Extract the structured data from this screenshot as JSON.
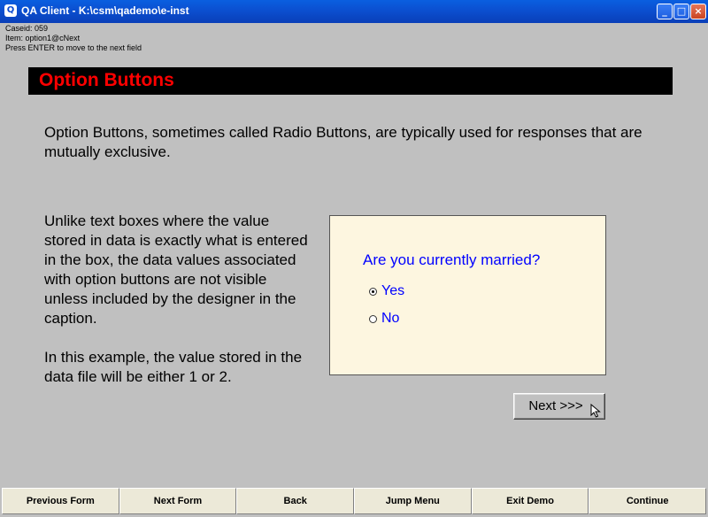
{
  "window": {
    "title": "QA Client - K:\\csm\\qademo\\e-inst",
    "app_icon": "app-icon",
    "minimize": "_",
    "maximize": "□",
    "close": "×"
  },
  "status": {
    "caseid": "Caseid: 059",
    "item": "Item: option1@cNext",
    "hint": "Press ENTER to move to the next field"
  },
  "header": {
    "title": "Option Buttons",
    "title_color": "#ff0000",
    "bar_color": "#000000"
  },
  "intro": "Option Buttons, sometimes called Radio Buttons, are typically used for responses that are mutually exclusive.",
  "explain": {
    "para1": "Unlike text boxes where the value stored in data is exactly what is entered in the box, the data values associated with option buttons are not visible unless included by the designer in the caption.",
    "para2": "In this example, the value stored in the data file will be either 1 or 2."
  },
  "question": {
    "text": "Are you currently married?",
    "text_color": "#0000ff",
    "panel_color": "#fdf6e0",
    "options": [
      {
        "label": "Yes",
        "selected": true
      },
      {
        "label": "No",
        "selected": false
      }
    ]
  },
  "next_button": {
    "label": "Next >>>"
  },
  "toolbar": {
    "buttons": [
      "Previous Form",
      "Next Form",
      "Back",
      "Jump Menu",
      "Exit Demo",
      "Continue"
    ]
  }
}
